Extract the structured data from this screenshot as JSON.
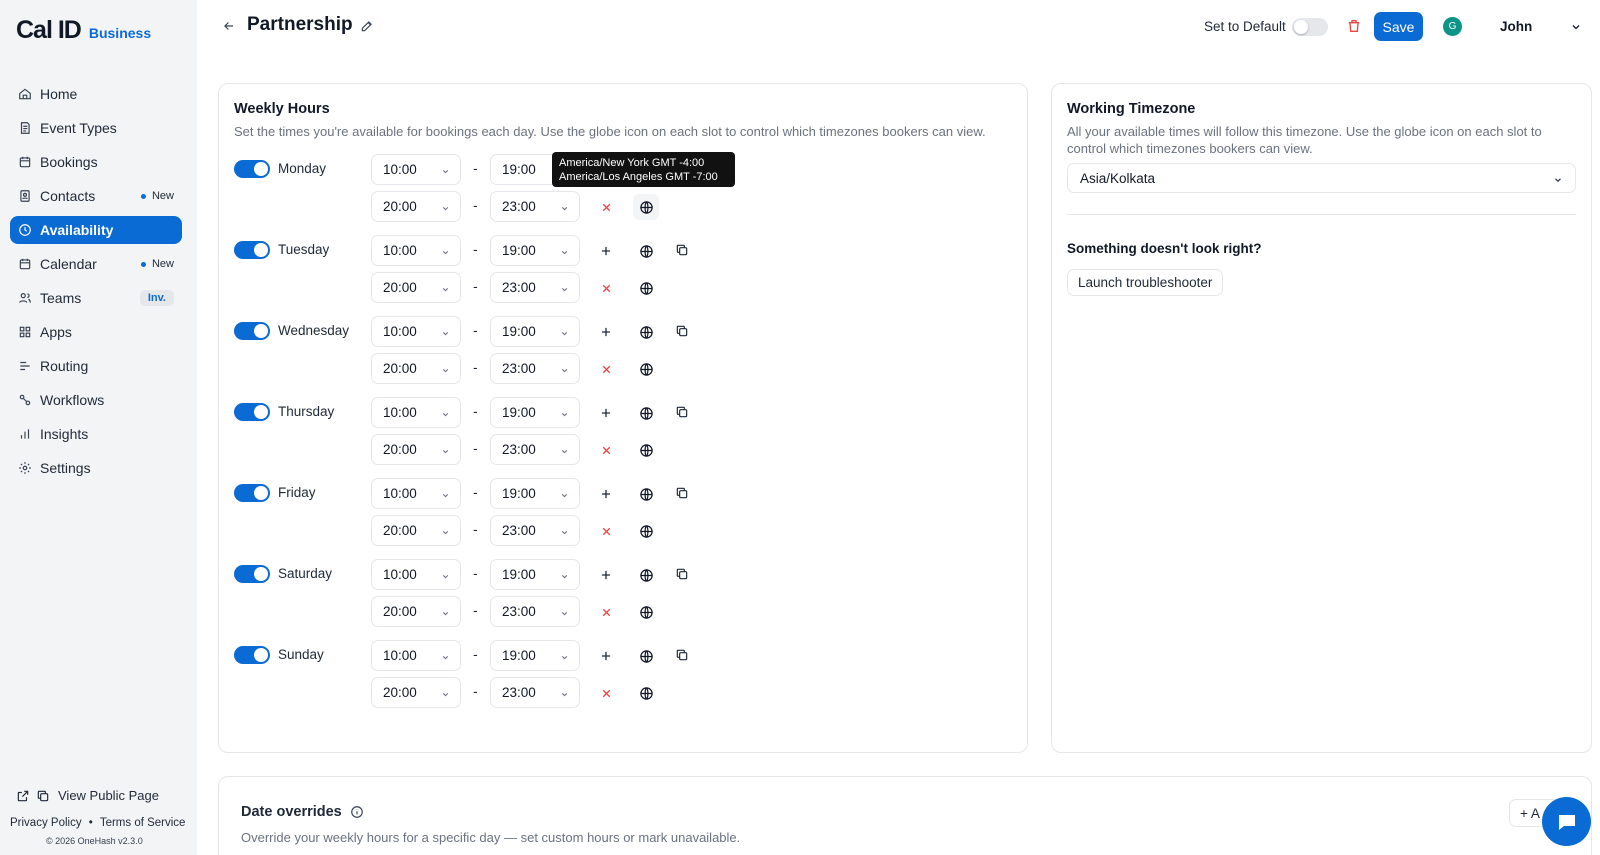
{
  "brand": {
    "name": "Cal ID",
    "tier": "Business"
  },
  "nav": [
    {
      "label": "Home",
      "icon": "home-icon",
      "badge": ""
    },
    {
      "label": "Event Types",
      "icon": "event-types-icon",
      "badge": ""
    },
    {
      "label": "Bookings",
      "icon": "calendar-icon",
      "badge": ""
    },
    {
      "label": "Contacts",
      "icon": "contacts-icon",
      "badge": "New"
    },
    {
      "label": "Availability",
      "icon": "clock-icon",
      "badge": "",
      "active": true
    },
    {
      "label": "Calendar",
      "icon": "calendar-icon",
      "badge": "New"
    },
    {
      "label": "Teams",
      "icon": "users-icon",
      "badge": "Inv."
    },
    {
      "label": "Apps",
      "icon": "grid-icon",
      "badge": ""
    },
    {
      "label": "Routing",
      "icon": "routing-icon",
      "badge": ""
    },
    {
      "label": "Workflows",
      "icon": "workflow-icon",
      "badge": ""
    },
    {
      "label": "Insights",
      "icon": "bar-chart-icon",
      "badge": ""
    },
    {
      "label": "Settings",
      "icon": "gear-icon",
      "badge": ""
    }
  ],
  "sidebar_footer": {
    "view_public": "View Public Page",
    "privacy": "Privacy Policy",
    "separator": "•",
    "terms": "Terms of Service",
    "copyright": "© 2026 OneHash v2.3.0"
  },
  "header": {
    "title": "Partnership",
    "set_default_label": "Set to Default",
    "save_label": "Save",
    "avatar_initial": "G",
    "user_name": "John"
  },
  "weekly": {
    "title": "Weekly Hours",
    "description": "Set the times you're available for bookings each day. Use the globe icon on each slot to control which timezones bookers can view.",
    "dash": "-",
    "days": [
      {
        "name": "Monday",
        "slot1": [
          "10:00",
          "19:00"
        ],
        "slot2": [
          "20:00",
          "23:00"
        ]
      },
      {
        "name": "Tuesday",
        "slot1": [
          "10:00",
          "19:00"
        ],
        "slot2": [
          "20:00",
          "23:00"
        ]
      },
      {
        "name": "Wednesday",
        "slot1": [
          "10:00",
          "19:00"
        ],
        "slot2": [
          "20:00",
          "23:00"
        ]
      },
      {
        "name": "Thursday",
        "slot1": [
          "10:00",
          "19:00"
        ],
        "slot2": [
          "20:00",
          "23:00"
        ]
      },
      {
        "name": "Friday",
        "slot1": [
          "10:00",
          "19:00"
        ],
        "slot2": [
          "20:00",
          "23:00"
        ]
      },
      {
        "name": "Saturday",
        "slot1": [
          "10:00",
          "19:00"
        ],
        "slot2": [
          "20:00",
          "23:00"
        ]
      },
      {
        "name": "Sunday",
        "slot1": [
          "10:00",
          "19:00"
        ],
        "slot2": [
          "20:00",
          "23:00"
        ]
      }
    ],
    "tooltip": [
      "America/New York GMT -4:00",
      "America/Los Angeles GMT -7:00"
    ]
  },
  "timezone": {
    "title": "Working Timezone",
    "description": "All your available times will follow this timezone. Use the globe icon on each slot to control which timezones bookers can view.",
    "value": "Asia/Kolkata",
    "question": "Something doesn't look right?",
    "troubleshooter_label": "Launch troubleshooter"
  },
  "overrides": {
    "title": "Date overrides",
    "description": "Override your weekly hours for a specific day — set custom hours or mark unavailable.",
    "add_label": "+ A"
  },
  "colors": {
    "accent": "#0b6bd4",
    "danger": "#ef4444",
    "avatar": "#0d9488"
  }
}
